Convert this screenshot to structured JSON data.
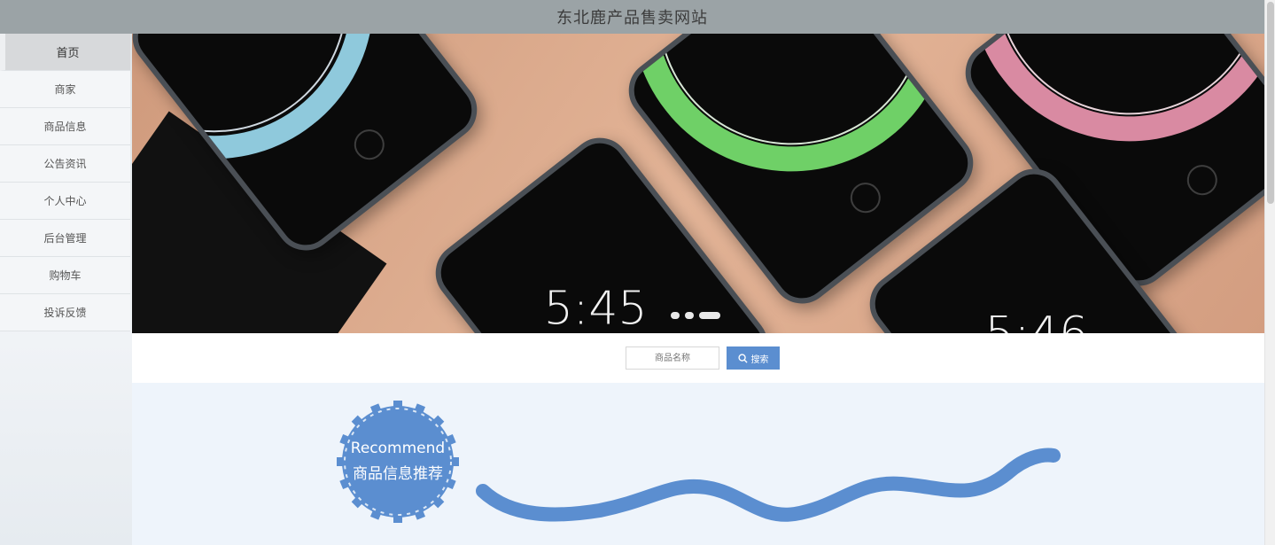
{
  "header": {
    "title": "东北鹿产品售卖网站"
  },
  "sidebar": {
    "items": [
      {
        "label": "首页",
        "active": true
      },
      {
        "label": "商家",
        "active": false
      },
      {
        "label": "商品信息",
        "active": false
      },
      {
        "label": "公告资讯",
        "active": false
      },
      {
        "label": "个人中心",
        "active": false
      },
      {
        "label": "后台管理",
        "active": false
      },
      {
        "label": "购物车",
        "active": false
      },
      {
        "label": "投诉反馈",
        "active": false
      }
    ]
  },
  "banner": {
    "slides_count": 3,
    "active_slide": 3,
    "phone_clocks": [
      "5:45",
      "5:46"
    ]
  },
  "search": {
    "placeholder": "商品名称",
    "button_label": "搜索"
  },
  "recommend": {
    "title_en": "Recommend",
    "title_cn": "商品信息推荐"
  },
  "colors": {
    "header_bg": "#9ba3a6",
    "accent_blue": "#5b8ed0",
    "badge_blue": "#5b8ed0",
    "section_bg": "#eef4fb"
  }
}
